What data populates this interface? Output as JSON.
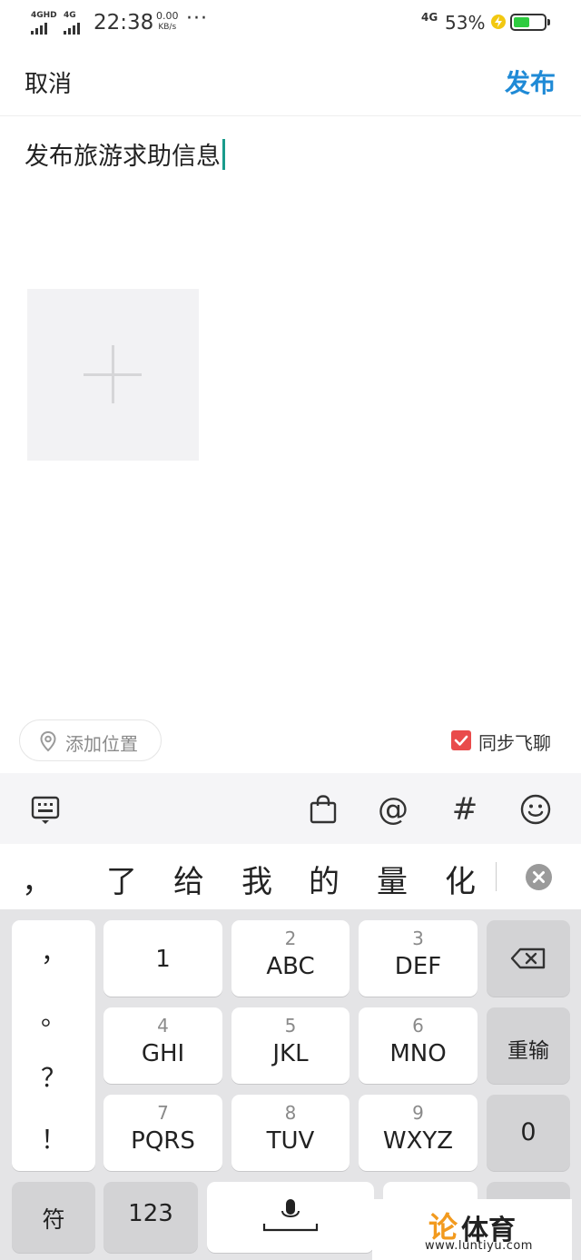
{
  "status_bar": {
    "signal1_label": "4GHD",
    "signal2_label": "4G",
    "time": "22:38",
    "speed_value": "0.00",
    "speed_unit": "KB/s",
    "more": "···",
    "network_right": "4G",
    "battery_pct": "53%",
    "battery_level": 0.53,
    "battery_color": "#2ecc40"
  },
  "header": {
    "cancel_label": "取消",
    "publish_label": "发布",
    "publish_color": "#1f8ad6"
  },
  "compose": {
    "text": "发布旅游求助信息",
    "add_photo_icon": "plus-icon"
  },
  "location": {
    "icon": "location-pin-icon",
    "label": "添加位置"
  },
  "sync": {
    "label": "同步飞聊",
    "checked": true,
    "color": "#e94b4b"
  },
  "toolbar": {
    "icons": [
      "keyboard-toggle-icon",
      "shopping-bag-icon",
      "mention-icon",
      "hashtag-icon",
      "emoji-icon"
    ],
    "at_symbol": "@",
    "hash_symbol": "#"
  },
  "candidates": {
    "items": [
      "，",
      "了",
      "给",
      "我",
      "的",
      "量",
      "化"
    ]
  },
  "keyboard": {
    "punctuation": [
      "，",
      "。",
      "？",
      "！"
    ],
    "keys": [
      {
        "num": "",
        "main": "1"
      },
      {
        "num": "2",
        "main": "ABC"
      },
      {
        "num": "3",
        "main": "DEF"
      },
      {
        "num": "4",
        "main": "GHI"
      },
      {
        "num": "5",
        "main": "JKL"
      },
      {
        "num": "6",
        "main": "MNO"
      },
      {
        "num": "7",
        "main": "PQRS"
      },
      {
        "num": "8",
        "main": "TUV"
      },
      {
        "num": "9",
        "main": "WXYZ"
      }
    ],
    "reenter_label": "重输",
    "zero_label": "0",
    "symbol_label": "符",
    "numeric_label": "123"
  },
  "watermark": {
    "mark": "论",
    "name": "体育",
    "url": "www.luntiyu.com"
  }
}
